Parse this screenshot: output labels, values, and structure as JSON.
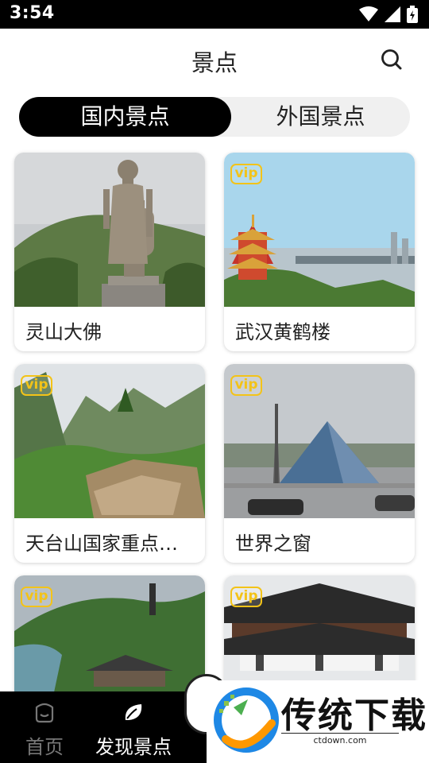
{
  "status_bar": {
    "time": "3:54"
  },
  "header": {
    "title": "景点",
    "search_icon": "search-icon"
  },
  "tabs": [
    {
      "label": "国内景点",
      "active": true
    },
    {
      "label": "外国景点",
      "active": false
    }
  ],
  "attractions": [
    {
      "name": "灵山大佛",
      "vip": false
    },
    {
      "name": "武汉黄鹤楼",
      "vip": true,
      "badge": "vip"
    },
    {
      "name": "天台山国家重点风景名胜区",
      "vip": true,
      "badge": "vip"
    },
    {
      "name": "世界之窗",
      "vip": true,
      "badge": "vip"
    },
    {
      "name": "",
      "vip": true,
      "badge": "vip"
    },
    {
      "name": "",
      "vip": true,
      "badge": "vip"
    }
  ],
  "bottom_nav": [
    {
      "label": "首页",
      "icon": "home-icon",
      "active": false
    },
    {
      "label": "发现景点",
      "icon": "leaf-icon",
      "active": true
    }
  ],
  "watermark": {
    "title": "传统下载",
    "url": "ctdown.com"
  },
  "colors": {
    "vip": "#f3c318",
    "active_tab": "#000000",
    "tab_track": "#f0f0f0"
  }
}
